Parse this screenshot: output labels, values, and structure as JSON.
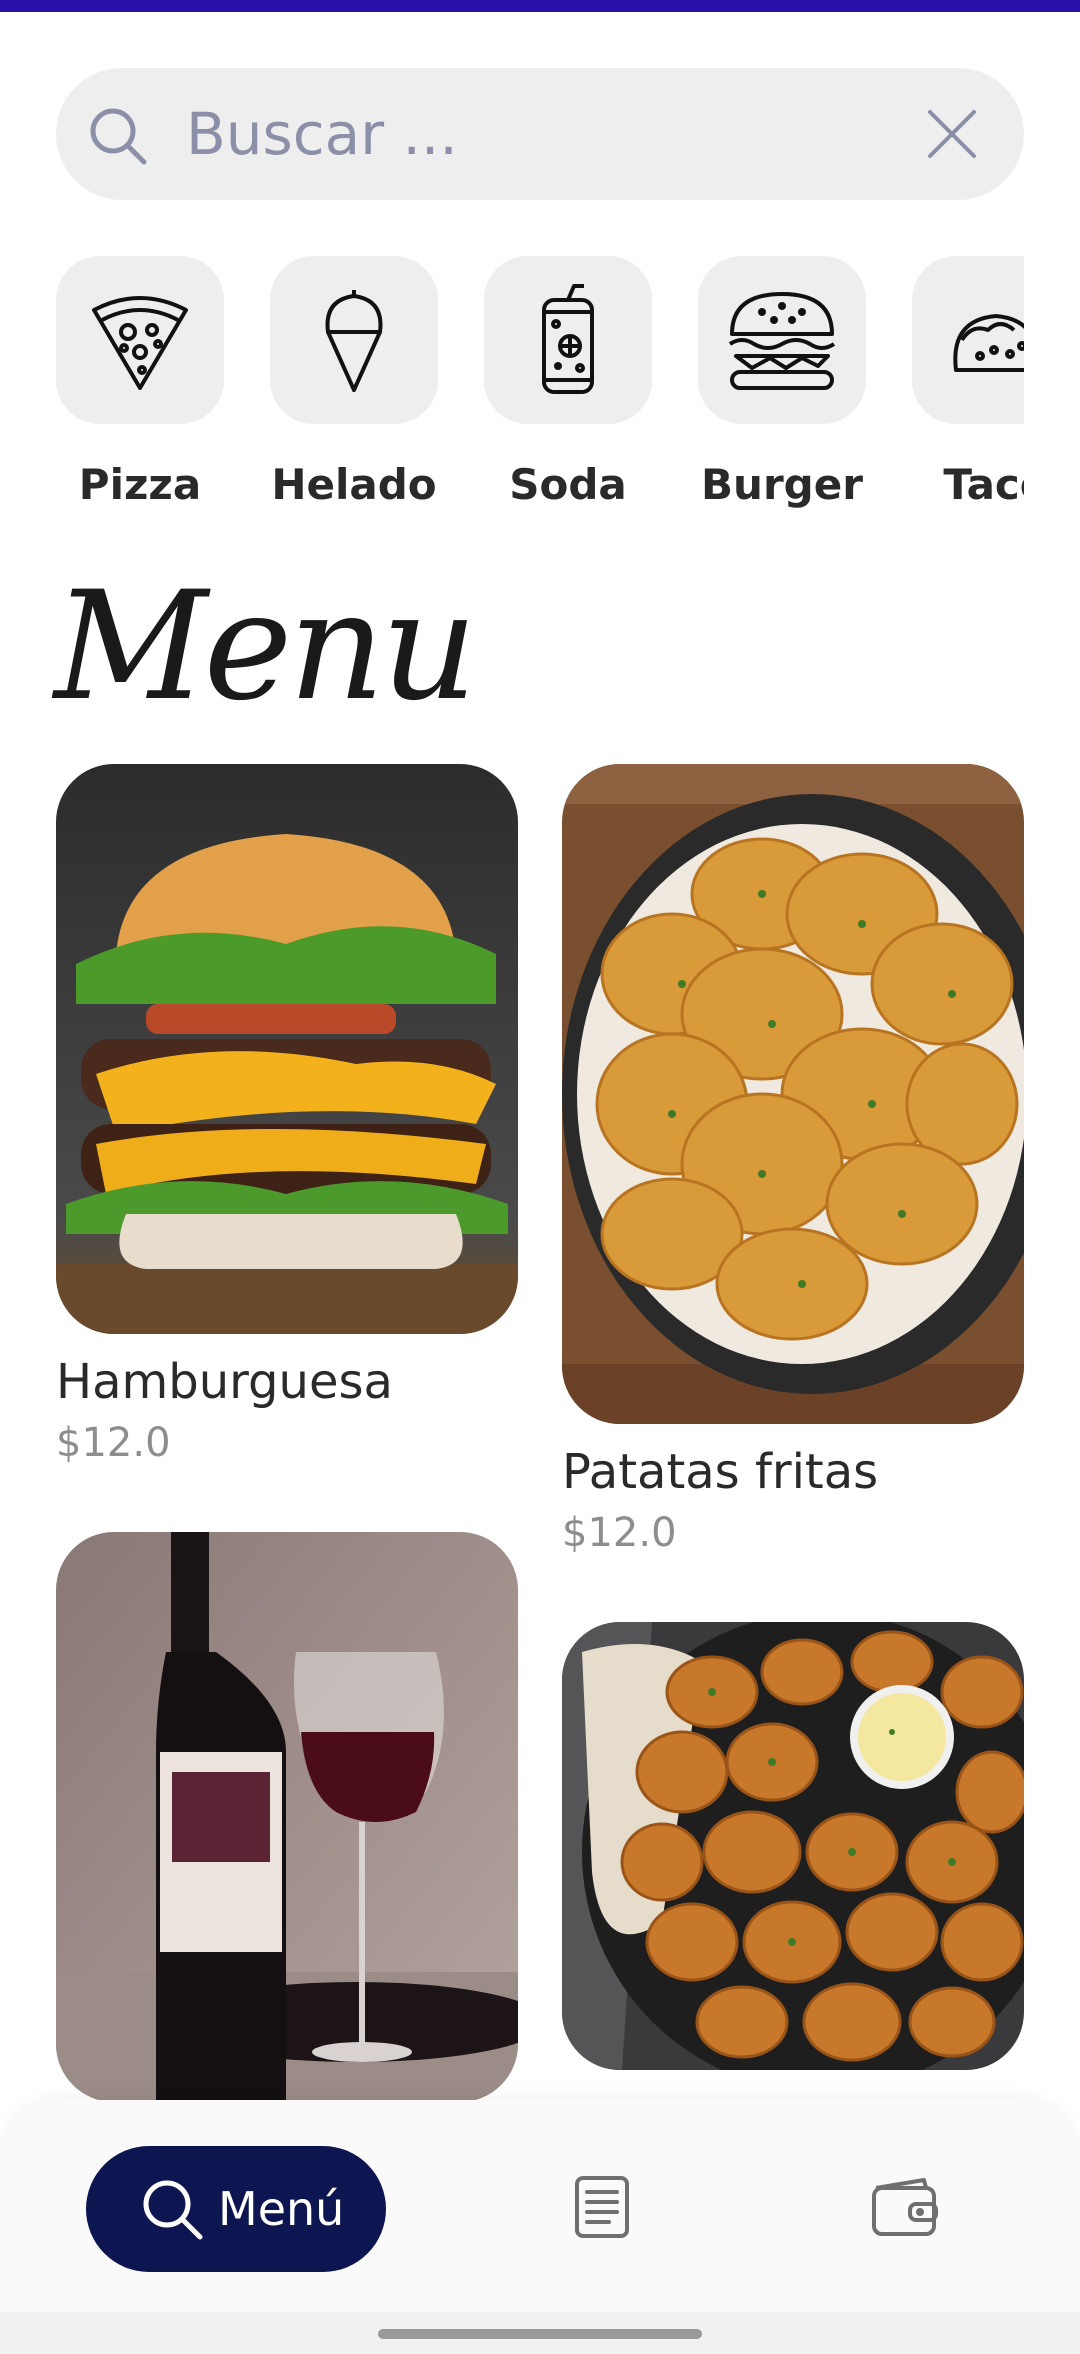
{
  "search": {
    "placeholder": "Buscar ..."
  },
  "categories": [
    {
      "label": "Pizza",
      "icon": "pizza-icon"
    },
    {
      "label": "Helado",
      "icon": "ice-cream-icon"
    },
    {
      "label": "Soda",
      "icon": "soda-can-icon"
    },
    {
      "label": "Burger",
      "icon": "burger-icon"
    },
    {
      "label": "Taco",
      "icon": "taco-icon"
    }
  ],
  "menu": {
    "title": "Menu",
    "items": [
      {
        "name": "Hamburguesa",
        "price": "$12.0"
      },
      {
        "name": "Patatas fritas",
        "price": "$12.0"
      },
      {
        "name": "",
        "price": ""
      },
      {
        "name": "",
        "price": ""
      }
    ]
  },
  "nav": {
    "menu_label": "Menú",
    "orders_icon": "document-icon",
    "wallet_icon": "wallet-icon"
  },
  "colors": {
    "accent": "#2a0fa8",
    "nav_active_bg": "#0d1650",
    "tile_bg": "#eeeeee"
  }
}
